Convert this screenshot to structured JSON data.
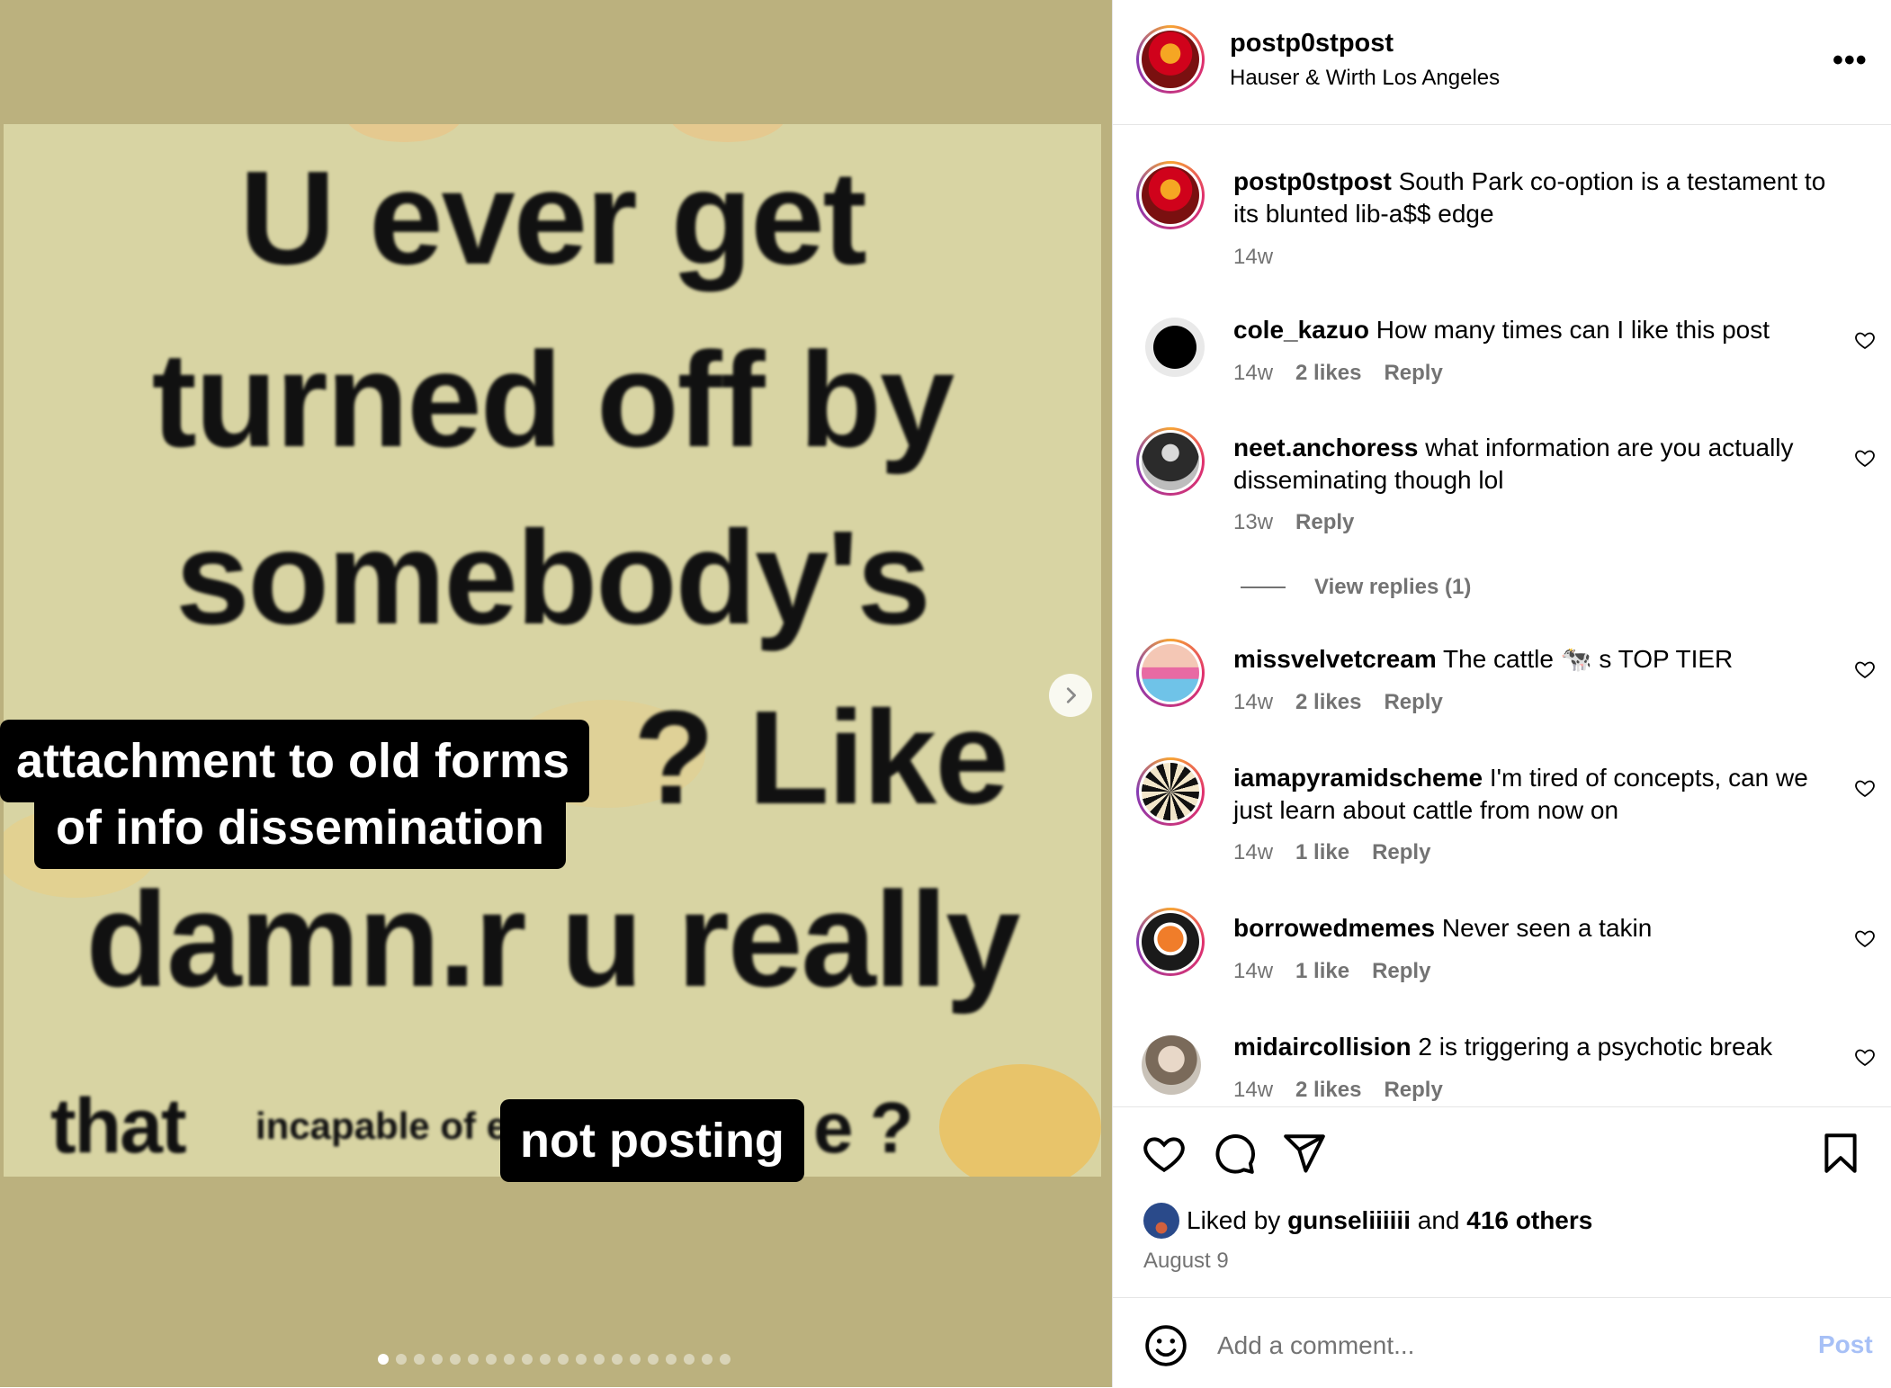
{
  "post": {
    "username": "postp0stpost",
    "location": "Hauser & Wirth Los Angeles",
    "caption_text": "South Park co-option is a testament to its blunted lib-a$$ edge",
    "caption_time": "14w"
  },
  "media": {
    "meme_lines": [
      "U ever get",
      "turned off by",
      "somebody's",
      "? Like",
      "damn.r u really",
      "that",
      "incapable of e",
      "e ?"
    ],
    "overlay_caption_1_line_1": "attachment to old forms",
    "overlay_caption_1_line_2": "of info dissemination",
    "overlay_caption_2": "not posting",
    "slide_count": 20,
    "active_slide": 1
  },
  "comments": [
    {
      "username": "cole_kazuo",
      "text": "How many times can I like this post",
      "time": "14w",
      "likes": "2 likes",
      "reply": "Reply"
    },
    {
      "username": "neet.anchoress",
      "text": "what information are you actually disseminating though lol",
      "time": "13w",
      "likes": "",
      "reply": "Reply"
    },
    {
      "username": "missvelvetcream",
      "text": "The cattle 🐄 s TOP TIER",
      "time": "14w",
      "likes": "2 likes",
      "reply": "Reply"
    },
    {
      "username": "iamapyramidscheme",
      "text": "I'm tired of concepts, can we just learn about cattle from now on",
      "time": "14w",
      "likes": "1 like",
      "reply": "Reply"
    },
    {
      "username": "borrowedmemes",
      "text": "Never seen a takin",
      "time": "14w",
      "likes": "1 like",
      "reply": "Reply"
    },
    {
      "username": "midaircollision",
      "text": "2 is triggering a psychotic break",
      "time": "14w",
      "likes": "2 likes",
      "reply": "Reply"
    }
  ],
  "view_replies": "View replies (1)",
  "likes": {
    "prefix": "Liked by",
    "user": "gunseliiiiii",
    "and": "and",
    "others": "416 others"
  },
  "date": "August 9",
  "comment_box": {
    "placeholder": "Add a comment...",
    "post_label": "Post"
  },
  "icons": {
    "more": "more-options-icon",
    "next": "chevron-right-icon",
    "like": "heart-icon",
    "comment": "comment-icon",
    "share": "share-icon",
    "save": "bookmark-icon",
    "emoji": "emoji-icon"
  },
  "colors": {
    "link_blue_disabled": "#a7c0f6",
    "meta_gray": "#737373",
    "story_ring": "#e1306c",
    "media_bg": "#bbb17e"
  }
}
